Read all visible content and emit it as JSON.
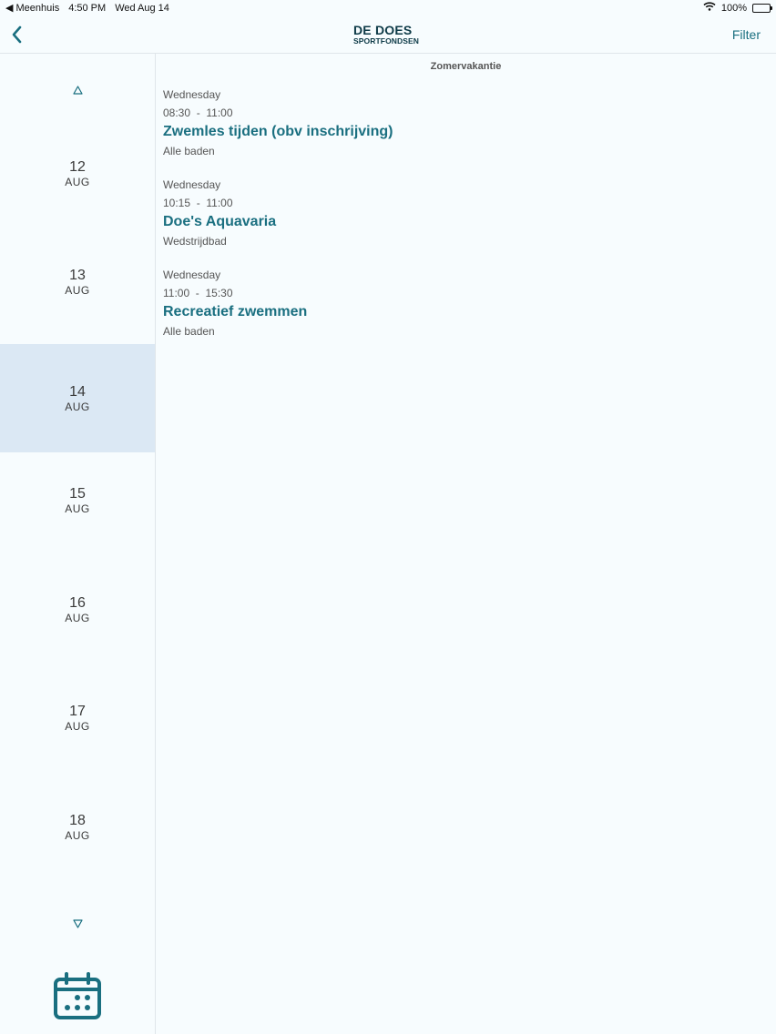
{
  "status": {
    "back_app": "◀ Meenhuis",
    "time": "4:50 PM",
    "date": "Wed Aug 14",
    "battery": "100%"
  },
  "nav": {
    "logo_line1": "DE DOES",
    "logo_line2": "SPORTFONDSEN",
    "filter_label": "Filter"
  },
  "sidebar": {
    "days": [
      {
        "num": "12",
        "mon": "AUG"
      },
      {
        "num": "13",
        "mon": "AUG"
      },
      {
        "num": "14",
        "mon": "AUG"
      },
      {
        "num": "15",
        "mon": "AUG"
      },
      {
        "num": "16",
        "mon": "AUG"
      },
      {
        "num": "17",
        "mon": "AUG"
      },
      {
        "num": "18",
        "mon": "AUG"
      }
    ],
    "selected_day": "14"
  },
  "content": {
    "period_title": "Zomervakantie",
    "events": [
      {
        "day": "Wednesday",
        "time": "08:30  -  11:00",
        "title": "Zwemles tijden (obv inschrijving)",
        "location": "Alle baden"
      },
      {
        "day": "Wednesday",
        "time": "10:15  -  11:00",
        "title": "Doe's Aquavaria",
        "location": "Wedstrijdbad"
      },
      {
        "day": "Wednesday",
        "time": "11:00  -  15:30",
        "title": "Recreatief zwemmen",
        "location": "Alle baden"
      }
    ]
  },
  "colors": {
    "accent": "#1a6f80",
    "selected_bg": "#dbe8f4",
    "background": "#f7fcfe"
  }
}
